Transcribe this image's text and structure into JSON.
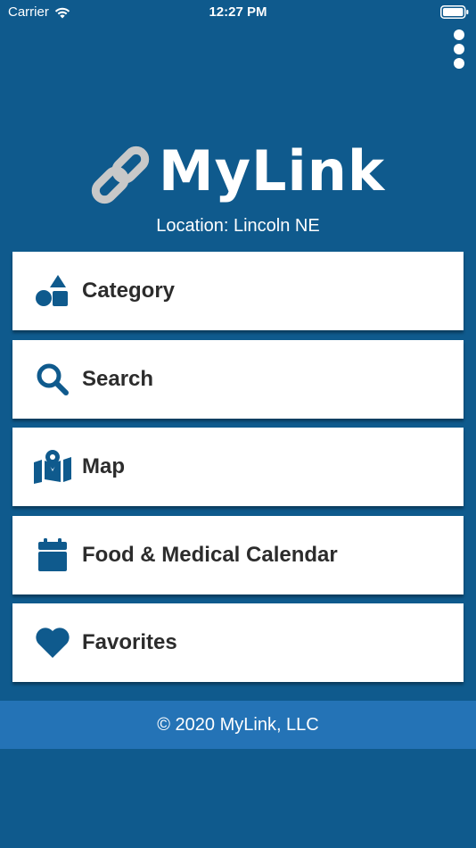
{
  "status_bar": {
    "carrier": "Carrier",
    "time": "12:27 PM"
  },
  "header": {
    "more_icon": "more-vertical-icon"
  },
  "brand": {
    "logo_text": "MyLink",
    "logo_icon": "link-icon"
  },
  "location": {
    "label": "Location: Lincoln NE"
  },
  "menu": {
    "items": [
      {
        "label": "Category",
        "icon": "shapes-icon"
      },
      {
        "label": "Search",
        "icon": "search-icon"
      },
      {
        "label": "Map",
        "icon": "map-icon"
      },
      {
        "label": "Food & Medical Calendar",
        "icon": "calendar-icon"
      },
      {
        "label": "Favorites",
        "icon": "heart-icon"
      }
    ]
  },
  "footer": {
    "copyright": "© 2020 MyLink, LLC"
  },
  "colors": {
    "background": "#0f5a8d",
    "footer": "#2473b6",
    "icon": "#0f5a8d",
    "card": "#ffffff",
    "text": "#2c2c2c"
  }
}
